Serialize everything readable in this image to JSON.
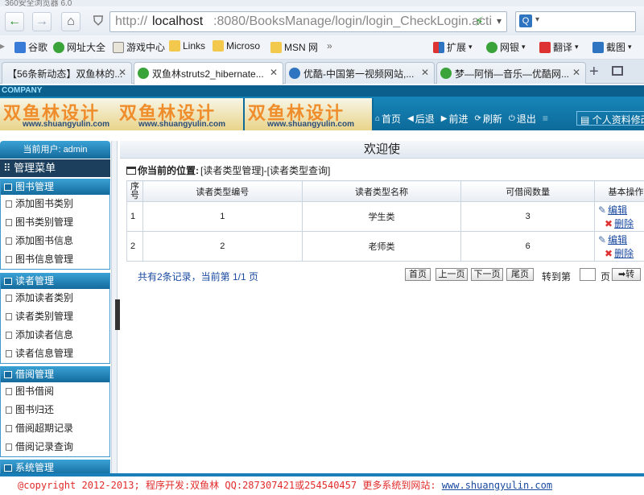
{
  "browser": {
    "window_title_fragment": "360安全浏览器 6.0",
    "address": {
      "scheme": "http://",
      "host": "localhost",
      "rest": ":8080/BooksManage/login/login_CheckLogin.acti"
    },
    "favorites": [
      "谷歌",
      "网址大全",
      "游戏中心",
      "Links",
      "Microso",
      "MSN 网"
    ],
    "favorites_more": "»",
    "extensions": [
      "扩展",
      "网银",
      "翻译",
      "截图"
    ],
    "tabs": [
      {
        "title": "【56条新动态】双鱼林的..."
      },
      {
        "title": "双鱼林struts2_hibernate..."
      },
      {
        "title": "优酷-中国第一视频网站,..."
      },
      {
        "title": "梦—阿悄—音乐—优酷网..."
      }
    ],
    "new_tab": "+"
  },
  "header": {
    "company": "COMPANY",
    "logo_text": "双鱼林设计",
    "logo_url": "www.shuangyulin.com",
    "nav": [
      {
        "icon": "home-icon",
        "label": "首页"
      },
      {
        "icon": "back-icon",
        "label": "后退"
      },
      {
        "icon": "forward-icon",
        "label": "前进"
      },
      {
        "icon": "refresh-icon",
        "label": "刷新"
      },
      {
        "icon": "power-icon",
        "label": "退出"
      }
    ],
    "profile_label": "个人资料修改"
  },
  "sidebar": {
    "current_user": "当前用户: admin",
    "menu_title": "管理菜单",
    "groups": [
      {
        "title": "图书管理",
        "items": [
          "添加图书类别",
          "图书类别管理",
          "添加图书信息",
          "图书信息管理"
        ]
      },
      {
        "title": "读者管理",
        "items": [
          "添加读者类别",
          "读者类别管理",
          "添加读者信息",
          "读者信息管理"
        ]
      },
      {
        "title": "借阅管理",
        "items": [
          "图书借阅",
          "图书归还",
          "借阅超期记录",
          "借阅记录查询"
        ]
      },
      {
        "title": "系统管理",
        "items": []
      }
    ]
  },
  "main": {
    "welcome": "欢迎使",
    "location_label": "你当前的位置:",
    "location_path": "[读者类型管理]-[读者类型查询]",
    "columns": [
      "序号",
      "读者类型编号",
      "读者类型名称",
      "可借阅数量",
      "基本操作"
    ],
    "rows": [
      {
        "no": "1",
        "code": "1",
        "name": "学生类",
        "count": "3"
      },
      {
        "no": "2",
        "code": "2",
        "name": "老师类",
        "count": "6"
      }
    ],
    "ops": {
      "edit": "编辑",
      "delete": "删除"
    },
    "pager": {
      "summary": "共有2条记录，当前第 1/1 页",
      "first": "首页",
      "prev": "上一页",
      "next": "下一页",
      "last": "尾页",
      "goto_prefix": "转到第",
      "goto_suffix": "页",
      "go": "➡转"
    }
  },
  "footer": {
    "text": "@copyright 2012-2013; 程序开发:双鱼林  QQ:287307421或254540457  更多系统到网站: ",
    "link": "www.shuangyulin.com"
  }
}
